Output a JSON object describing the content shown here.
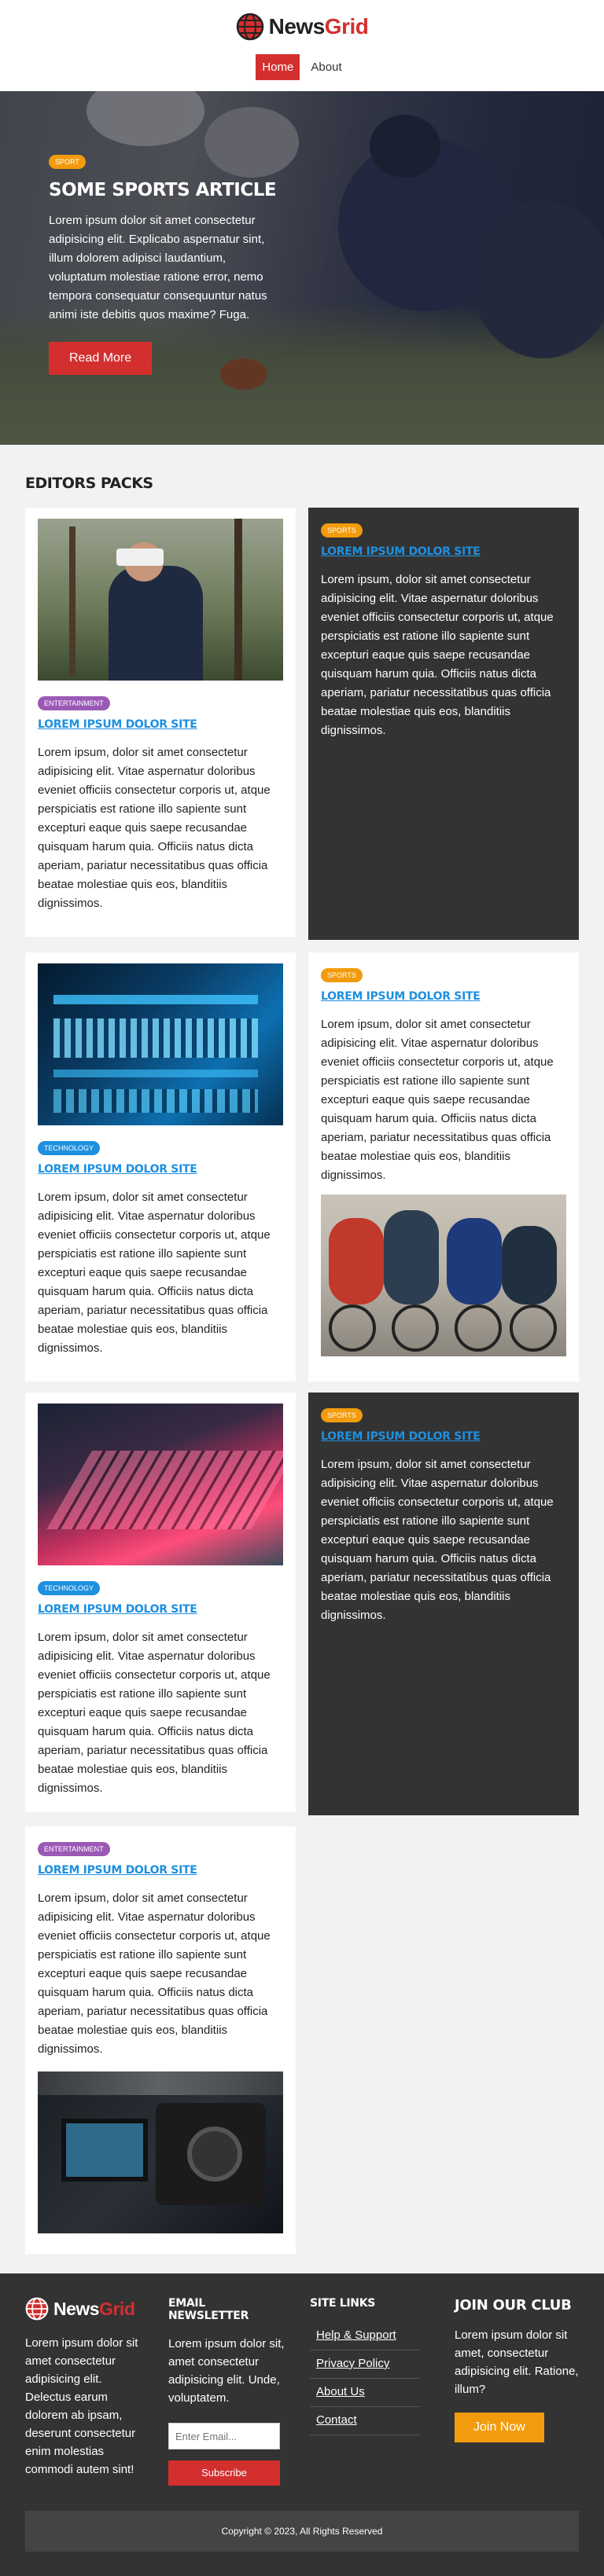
{
  "header": {
    "logo_primary": "News",
    "logo_secondary": "Grid",
    "nav": [
      {
        "label": "Home",
        "active": true
      },
      {
        "label": "About",
        "active": false
      }
    ]
  },
  "hero": {
    "badge": "Sport",
    "title": "SOME SPORTS ARTICLE",
    "text": "Lorem ipsum dolor sit amet consectetur adipisicing elit. Explicabo aspernatur sint, illum dolorem adipisci laudantium, voluptatum molestiae ratione error, nemo tempora consequatur consequuntur natus animi iste debitis quos maxime? Fuga.",
    "button": "Read More"
  },
  "section": {
    "title": "EDITORS PACKS"
  },
  "cards": [
    {
      "badge": "Entertainment",
      "title": "LOREM IPSUM DOLOR SITE",
      "text": "Lorem ipsum, dolor sit amet consectetur adipisicing elit. Vitae aspernatur doloribus eveniet officiis consectetur corporis ut, atque perspiciatis est ratione illo sapiente sunt excepturi eaque quis saepe recusandae quisquam harum quia. Officiis natus dicta aperiam, pariatur necessitatibus quas officia beatae molestiae quis eos, blanditiis dignissimos."
    },
    {
      "badge": "Sports",
      "title": "LOREM IPSUM DOLOR SITE",
      "text": "Lorem ipsum, dolor sit amet consectetur adipisicing elit. Vitae aspernatur doloribus eveniet officiis consectetur corporis ut, atque perspiciatis est ratione illo sapiente sunt excepturi eaque quis saepe recusandae quisquam harum quia. Officiis natus dicta aperiam, pariatur necessitatibus quas officia beatae molestiae quis eos, blanditiis dignissimos."
    },
    {
      "badge": "Technology",
      "title": "LOREM IPSUM DOLOR SITE",
      "text": "Lorem ipsum, dolor sit amet consectetur adipisicing elit. Vitae aspernatur doloribus eveniet officiis consectetur corporis ut, atque perspiciatis est ratione illo sapiente sunt excepturi eaque quis saepe recusandae quisquam harum quia. Officiis natus dicta aperiam, pariatur necessitatibus quas officia beatae molestiae quis eos, blanditiis dignissimos."
    },
    {
      "badge": "Sports",
      "title": "LOREM IPSUM DOLOR SITE",
      "text": "Lorem ipsum, dolor sit amet consectetur adipisicing elit. Vitae aspernatur doloribus eveniet officiis consectetur corporis ut, atque perspiciatis est ratione illo sapiente sunt excepturi eaque quis saepe recusandae quisquam harum quia. Officiis natus dicta aperiam, pariatur necessitatibus quas officia beatae molestiae quis eos, blanditiis dignissimos."
    },
    {
      "badge": "Technology",
      "title": "LOREM IPSUM DOLOR SITE",
      "text": "Lorem ipsum, dolor sit amet consectetur adipisicing elit. Vitae aspernatur doloribus eveniet officiis consectetur corporis ut, atque perspiciatis est ratione illo sapiente sunt excepturi eaque quis saepe recusandae quisquam harum quia. Officiis natus dicta aperiam, pariatur necessitatibus quas officia beatae molestiae quis eos, blanditiis dignissimos."
    },
    {
      "badge": "Sports",
      "title": "LOREM IPSUM DOLOR SITE",
      "text": "Lorem ipsum, dolor sit amet consectetur adipisicing elit. Vitae aspernatur doloribus eveniet officiis consectetur corporis ut, atque perspiciatis est ratione illo sapiente sunt excepturi eaque quis saepe recusandae quisquam harum quia. Officiis natus dicta aperiam, pariatur necessitatibus quas officia beatae molestiae quis eos, blanditiis dignissimos."
    },
    {
      "badge": "Entertainment",
      "title": "LOREM IPSUM DOLOR SITE",
      "text": "Lorem ipsum, dolor sit amet consectetur adipisicing elit. Vitae aspernatur doloribus eveniet officiis consectetur corporis ut, atque perspiciatis est ratione illo sapiente sunt excepturi eaque quis saepe recusandae quisquam harum quia. Officiis natus dicta aperiam, pariatur necessitatibus quas officia beatae molestiae quis eos, blanditiis dignissimos."
    }
  ],
  "footer": {
    "logo_primary": "News",
    "logo_secondary": "Grid",
    "about_text": "Lorem ipsum dolor sit amet consectetur adipisicing elit. Delectus earum dolorem ab ipsam, deserunt consectetur enim molestias commodi autem sint!",
    "newsletter": {
      "heading": "EMAIL NEWSLETTER",
      "text": "Lorem ipsum dolor sit, amet consectetur adipisicing elit. Unde, voluptatem.",
      "placeholder": "Enter Email...",
      "button": "Subscribe"
    },
    "links": {
      "heading": "SITE LINKS",
      "items": [
        "Help & Support",
        "Privacy Policy",
        "About Us",
        "Contact"
      ]
    },
    "club": {
      "heading": "JOIN OUR CLUB",
      "text": "Lorem ipsum dolor sit amet, consectetur adipisicing elit. Ratione, illum?",
      "button": "Join Now"
    },
    "copyright": "Copyright © 2023, All Rights Reserved"
  },
  "colors": {
    "brand_red": "#d32f2f",
    "sport_orange": "#f29b0c",
    "tech_blue": "#1e90e0",
    "entertainment_purple": "#9b59b6",
    "dark_card": "#333333"
  }
}
